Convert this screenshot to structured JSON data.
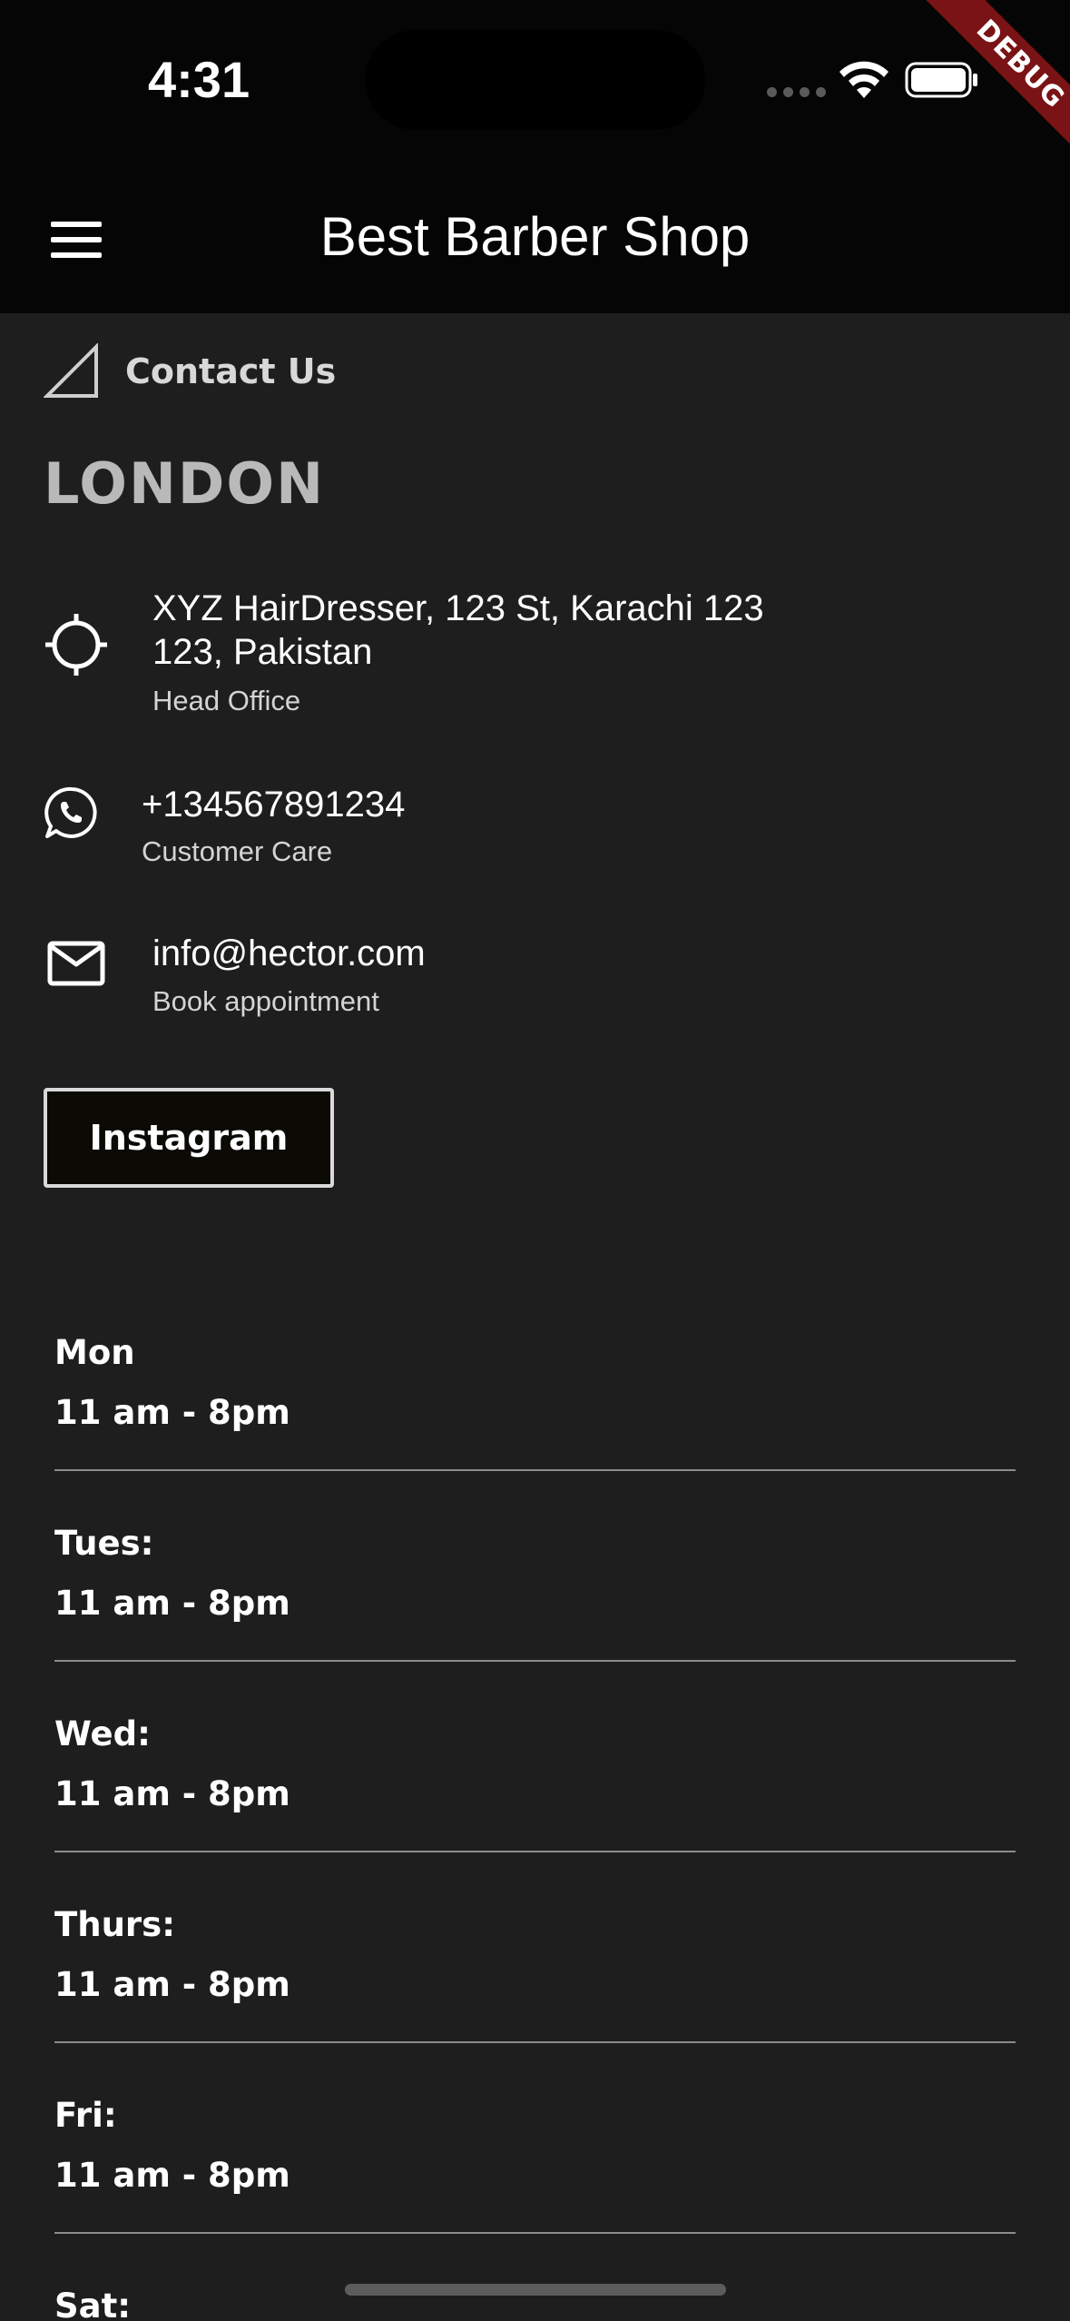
{
  "status_bar": {
    "time": "4:31",
    "debug_label": "DEBUG"
  },
  "app_bar": {
    "title": "Best Barber Shop",
    "menu_icon": "hamburger-menu-icon"
  },
  "section": {
    "icon": "triangle-icon",
    "title": "Contact Us"
  },
  "location": {
    "city": "LONDON"
  },
  "contacts": [
    {
      "icon": "location-target-icon",
      "main": "XYZ HairDresser, 123 St, Karachi 123 123, Pakistan",
      "sub": "Head Office"
    },
    {
      "icon": "whatsapp-icon",
      "main": "+134567891234",
      "sub": "Customer Care"
    },
    {
      "icon": "mail-icon",
      "main": "info@hector.com",
      "sub": "Book appointment"
    }
  ],
  "instagram_button": {
    "label": "Instagram"
  },
  "hours": [
    {
      "day": "Mon",
      "time": "11 am - 8pm"
    },
    {
      "day": "Tues:",
      "time": "11 am - 8pm"
    },
    {
      "day": "Wed:",
      "time": "11 am - 8pm"
    },
    {
      "day": "Thurs:",
      "time": "11 am - 8pm"
    },
    {
      "day": "Fri:",
      "time": "11 am - 8pm"
    },
    {
      "day": "Sat:",
      "time": ""
    }
  ],
  "colors": {
    "background": "#1e1e1f",
    "app_bar": "#050505",
    "debug_banner": "#7a1315",
    "button_bg": "#0c0a04",
    "divider": "#8c8c8c"
  }
}
